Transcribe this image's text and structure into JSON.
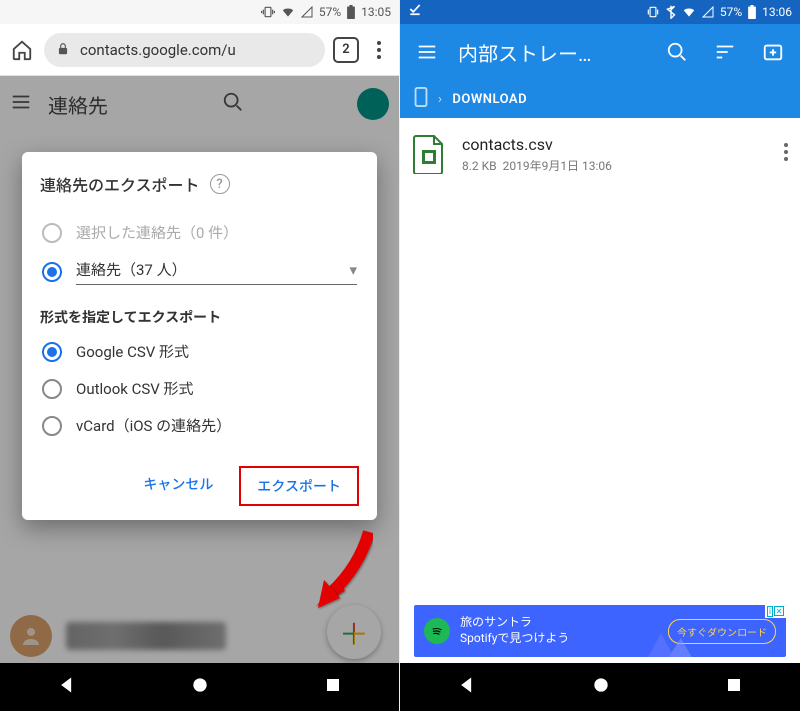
{
  "left": {
    "status": {
      "battery": "57%",
      "time": "13:05"
    },
    "browser": {
      "url": "contacts.google.com/u",
      "tab_count": "2"
    },
    "header": {
      "title": "連絡先"
    },
    "dialog": {
      "title": "連絡先のエクスポート",
      "source_options": {
        "selected_disabled": "選択した連絡先（0 件）",
        "contacts_dropdown": "連絡先（37 人）"
      },
      "format_section": "形式を指定してエクスポート",
      "formats": {
        "google_csv": "Google CSV 形式",
        "outlook_csv": "Outlook CSV 形式",
        "vcard": "vCard（iOS の連絡先）"
      },
      "cancel": "キャンセル",
      "export": "エクスポート"
    }
  },
  "right": {
    "status": {
      "battery": "57%",
      "time": "13:06"
    },
    "app": {
      "title": "内部ストレー…"
    },
    "breadcrumb": {
      "folder": "DOWNLOAD"
    },
    "file": {
      "name": "contacts.csv",
      "size": "8.2 KB",
      "date": "2019年9月1日 13:06"
    },
    "ad": {
      "line1": "旅のサントラ",
      "line2": "Spotifyで見つけよう",
      "cta": "今すぐダウンロード"
    }
  }
}
